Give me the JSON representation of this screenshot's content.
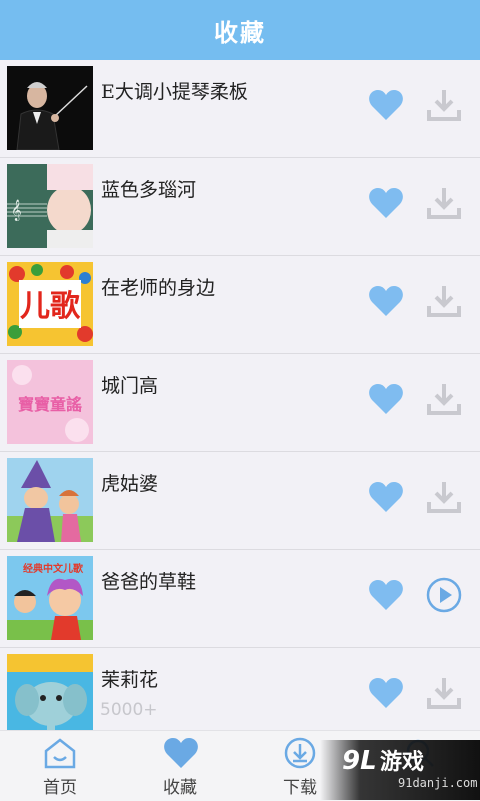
{
  "header": {
    "title": "收藏"
  },
  "items": [
    {
      "title": "E大调小提琴柔板",
      "thumbnail": "conductor-photo",
      "action": "download-icon"
    },
    {
      "title": "蓝色多瑙河",
      "thumbnail": "pregnant-woman-music-staff",
      "action": "download-icon"
    },
    {
      "title": "在老师的身边",
      "thumbnail": "children-songs-logo",
      "thumb_text": "儿歌",
      "action": "download-icon"
    },
    {
      "title": "城门高",
      "thumbnail": "pink-fairy-tale",
      "thumb_text": "寶寶童謠",
      "action": "download-icon"
    },
    {
      "title": "虎姑婆",
      "thumbnail": "wizard-cartoon",
      "action": "download-icon"
    },
    {
      "title": "爸爸的草鞋",
      "thumbnail": "cartoon-kids",
      "thumb_text": "经典中文儿歌",
      "action": "play-icon"
    },
    {
      "title": "茉莉花",
      "thumbnail": "elephant-cartoon",
      "action": "download-icon",
      "overlay_text": "5000+"
    }
  ],
  "tabs": [
    {
      "label": "首页",
      "icon": "home-icon"
    },
    {
      "label": "收藏",
      "icon": "heart-icon",
      "active": true
    },
    {
      "label": "下载",
      "icon": "download-tab-icon"
    },
    {
      "label": "",
      "icon": "search-icon"
    }
  ],
  "watermark": {
    "logo": "9L",
    "main": "游戏",
    "sub": "91danji.com"
  },
  "colors": {
    "accent": "#75bdf0",
    "heart": "#7fbcf0",
    "download_gray": "#c9c9cf",
    "background": "#f2f1f6"
  }
}
